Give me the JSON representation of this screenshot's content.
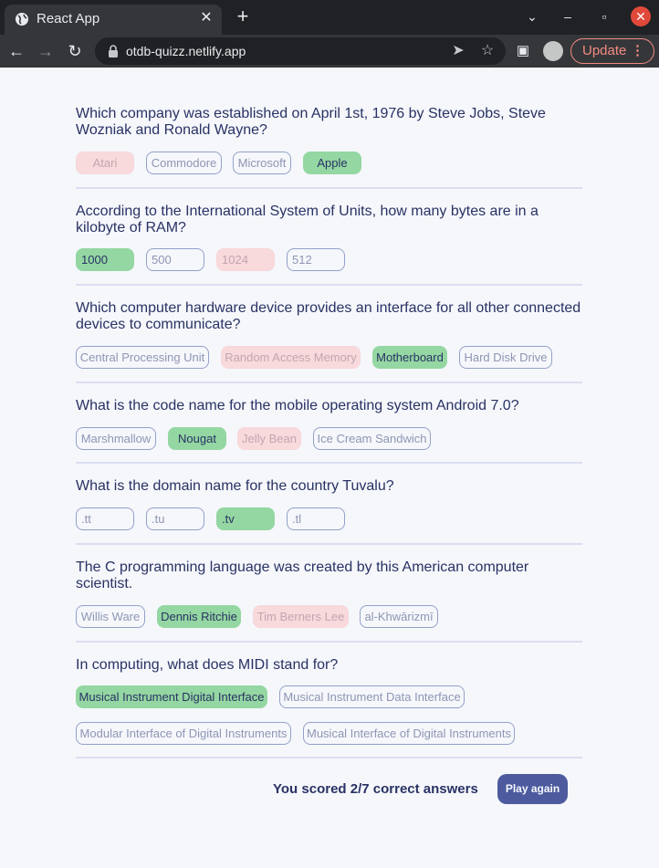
{
  "browser": {
    "tab_title": "React App",
    "url": "otdb-quizz.netlify.app",
    "update_label": "Update"
  },
  "colors": {
    "correct": "#94d7a2",
    "wrong": "#f8d9dc",
    "neutral_border": "#94a0c8",
    "text": "#293264",
    "button": "#4d5b9e"
  },
  "questions": [
    {
      "text": "Which company was established on April 1st, 1976 by Steve Jobs, Steve Wozniak and Ronald Wayne?",
      "answers": [
        {
          "label": "Atari",
          "state": "wrong"
        },
        {
          "label": "Commodore",
          "state": "neutral"
        },
        {
          "label": "Microsoft",
          "state": "neutral"
        },
        {
          "label": "Apple",
          "state": "correct"
        }
      ]
    },
    {
      "text": "According to the International System of Units, how many bytes are in a kilobyte of RAM?",
      "answers": [
        {
          "label": "1000",
          "state": "correct"
        },
        {
          "label": "500",
          "state": "neutral"
        },
        {
          "label": "1024",
          "state": "wrong"
        },
        {
          "label": "512",
          "state": "neutral"
        }
      ]
    },
    {
      "text": "Which computer hardware device provides an interface for all other connected devices to communicate?",
      "answers": [
        {
          "label": "Central Processing Unit",
          "state": "neutral"
        },
        {
          "label": "Random Access Memory",
          "state": "wrong"
        },
        {
          "label": "Motherboard",
          "state": "correct"
        },
        {
          "label": "Hard Disk Drive",
          "state": "neutral"
        }
      ]
    },
    {
      "text": "What is the code name for the mobile operating system Android 7.0?",
      "answers": [
        {
          "label": "Marshmallow",
          "state": "neutral"
        },
        {
          "label": "Nougat",
          "state": "correct"
        },
        {
          "label": "Jelly Bean",
          "state": "wrong"
        },
        {
          "label": "Ice Cream Sandwich",
          "state": "neutral"
        }
      ]
    },
    {
      "text": "What is the domain name for the country Tuvalu?",
      "answers": [
        {
          "label": ".tt",
          "state": "neutral"
        },
        {
          "label": ".tu",
          "state": "neutral"
        },
        {
          "label": ".tv",
          "state": "correct"
        },
        {
          "label": ".tl",
          "state": "neutral"
        }
      ]
    },
    {
      "text": "The C programming language was created by this American computer scientist.",
      "answers": [
        {
          "label": "Willis Ware",
          "state": "neutral"
        },
        {
          "label": "Dennis Ritchie",
          "state": "correct"
        },
        {
          "label": "Tim Berners Lee",
          "state": "wrong"
        },
        {
          "label": "al-Khwārizmī",
          "state": "neutral"
        }
      ]
    },
    {
      "text": "In computing, what does MIDI stand for?",
      "answers": [
        {
          "label": "Musical Instrument Digital Interface",
          "state": "correct"
        },
        {
          "label": "Musical Instrument Data Interface",
          "state": "neutral"
        },
        {
          "label": "Modular Interface of Digital Instruments",
          "state": "neutral"
        },
        {
          "label": "Musical Interface of Digital Instruments",
          "state": "neutral"
        }
      ]
    }
  ],
  "result": {
    "score_text": "You scored 2/7 correct answers",
    "play_again_label": "Play again"
  }
}
